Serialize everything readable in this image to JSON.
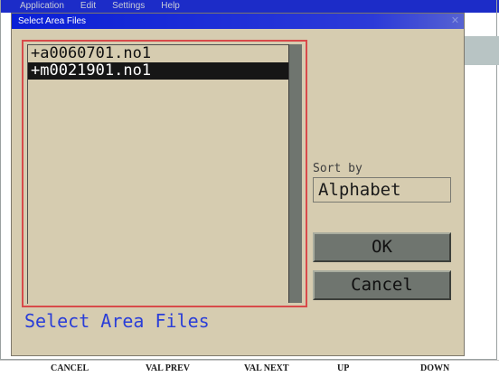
{
  "app": {
    "menu": [
      "Application",
      "Edit",
      "Settings",
      "Help"
    ]
  },
  "dialog": {
    "title": "Select Area Files",
    "close_glyph": "✕",
    "files": [
      {
        "name": "+a0060701.no1",
        "selected": false
      },
      {
        "name": "+m0021901.no1",
        "selected": true
      }
    ],
    "status": "Select Area Files",
    "sort_label": "Sort by",
    "sort_value": "Alphabet",
    "ok_label": "OK",
    "cancel_label": "Cancel"
  },
  "softkeys": [
    "CANCEL",
    "VAL PREV",
    "VAL NEXT",
    "UP",
    "DOWN"
  ]
}
